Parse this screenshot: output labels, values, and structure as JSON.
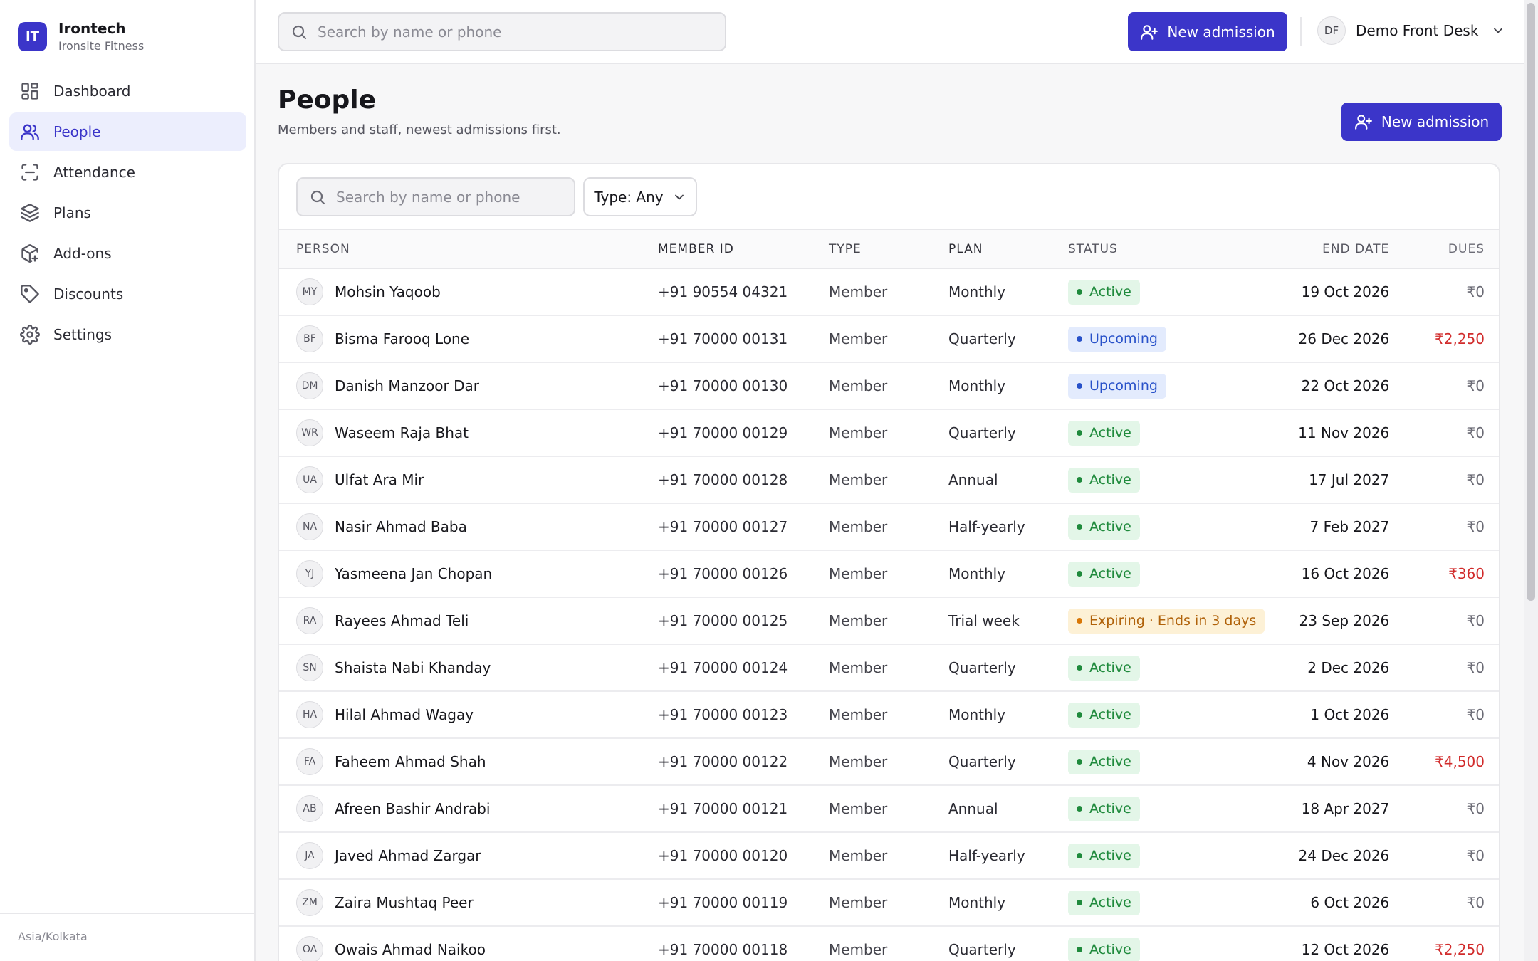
{
  "brand": {
    "initials": "IT",
    "name": "Irontech",
    "sub": "Ironsite Fitness"
  },
  "nav": [
    {
      "label": "Dashboard",
      "icon": "dashboard-icon"
    },
    {
      "label": "People",
      "icon": "people-icon",
      "active": true
    },
    {
      "label": "Attendance",
      "icon": "attendance-scan-icon"
    },
    {
      "label": "Plans",
      "icon": "layers-icon"
    },
    {
      "label": "Add-ons",
      "icon": "package-plus-icon"
    },
    {
      "label": "Discounts",
      "icon": "tag-icon"
    },
    {
      "label": "Settings",
      "icon": "gear-icon"
    }
  ],
  "timezone": "Asia/Kolkata",
  "topbar": {
    "search_placeholder": "Search by name or phone",
    "new_admission": "New admission",
    "user_initials": "DF",
    "user_name": "Demo Front Desk"
  },
  "page": {
    "title": "People",
    "subtitle": "Members and staff, newest admissions first.",
    "new_admission": "New admission"
  },
  "filters": {
    "search_placeholder": "Search by name or phone",
    "type_label": "Type: Any"
  },
  "table": {
    "columns": [
      "Person",
      "Member ID",
      "Type",
      "Plan",
      "Status",
      "End date",
      "Dues"
    ],
    "rows": [
      {
        "initials": "MY",
        "name": "Mohsin Yaqoob",
        "id": "+91 90554 04321",
        "type": "Member",
        "plan": "Monthly",
        "status": "Active",
        "status_kind": "active",
        "end": "19 Oct 2026",
        "dues": "₹0"
      },
      {
        "initials": "BF",
        "name": "Bisma Farooq Lone",
        "id": "+91 70000 00131",
        "type": "Member",
        "plan": "Quarterly",
        "status": "Upcoming",
        "status_kind": "upcoming",
        "end": "26 Dec 2026",
        "dues": "₹2,250"
      },
      {
        "initials": "DM",
        "name": "Danish Manzoor Dar",
        "id": "+91 70000 00130",
        "type": "Member",
        "plan": "Monthly",
        "status": "Upcoming",
        "status_kind": "upcoming",
        "end": "22 Oct 2026",
        "dues": "₹0"
      },
      {
        "initials": "WR",
        "name": "Waseem Raja Bhat",
        "id": "+91 70000 00129",
        "type": "Member",
        "plan": "Quarterly",
        "status": "Active",
        "status_kind": "active",
        "end": "11 Nov 2026",
        "dues": "₹0"
      },
      {
        "initials": "UA",
        "name": "Ulfat Ara Mir",
        "id": "+91 70000 00128",
        "type": "Member",
        "plan": "Annual",
        "status": "Active",
        "status_kind": "active",
        "end": "17 Jul 2027",
        "dues": "₹0"
      },
      {
        "initials": "NA",
        "name": "Nasir Ahmad Baba",
        "id": "+91 70000 00127",
        "type": "Member",
        "plan": "Half-yearly",
        "status": "Active",
        "status_kind": "active",
        "end": "7 Feb 2027",
        "dues": "₹0"
      },
      {
        "initials": "YJ",
        "name": "Yasmeena Jan Chopan",
        "id": "+91 70000 00126",
        "type": "Member",
        "plan": "Monthly",
        "status": "Active",
        "status_kind": "active",
        "end": "16 Oct 2026",
        "dues": "₹360"
      },
      {
        "initials": "RA",
        "name": "Rayees Ahmad Teli",
        "id": "+91 70000 00125",
        "type": "Member",
        "plan": "Trial week",
        "status": "Expiring · Ends in 3 days",
        "status_kind": "expiring",
        "end": "23 Sep 2026",
        "dues": "₹0"
      },
      {
        "initials": "SN",
        "name": "Shaista Nabi Khanday",
        "id": "+91 70000 00124",
        "type": "Member",
        "plan": "Quarterly",
        "status": "Active",
        "status_kind": "active",
        "end": "2 Dec 2026",
        "dues": "₹0"
      },
      {
        "initials": "HA",
        "name": "Hilal Ahmad Wagay",
        "id": "+91 70000 00123",
        "type": "Member",
        "plan": "Monthly",
        "status": "Active",
        "status_kind": "active",
        "end": "1 Oct 2026",
        "dues": "₹0"
      },
      {
        "initials": "FA",
        "name": "Faheem Ahmad Shah",
        "id": "+91 70000 00122",
        "type": "Member",
        "plan": "Quarterly",
        "status": "Active",
        "status_kind": "active",
        "end": "4 Nov 2026",
        "dues": "₹4,500"
      },
      {
        "initials": "AB",
        "name": "Afreen Bashir Andrabi",
        "id": "+91 70000 00121",
        "type": "Member",
        "plan": "Annual",
        "status": "Active",
        "status_kind": "active",
        "end": "18 Apr 2027",
        "dues": "₹0"
      },
      {
        "initials": "JA",
        "name": "Javed Ahmad Zargar",
        "id": "+91 70000 00120",
        "type": "Member",
        "plan": "Half-yearly",
        "status": "Active",
        "status_kind": "active",
        "end": "24 Dec 2026",
        "dues": "₹0"
      },
      {
        "initials": "ZM",
        "name": "Zaira Mushtaq Peer",
        "id": "+91 70000 00119",
        "type": "Member",
        "plan": "Monthly",
        "status": "Active",
        "status_kind": "active",
        "end": "6 Oct 2026",
        "dues": "₹0"
      },
      {
        "initials": "OA",
        "name": "Owais Ahmad Naikoo",
        "id": "+91 70000 00118",
        "type": "Member",
        "plan": "Quarterly",
        "status": "Active",
        "status_kind": "active",
        "end": "12 Oct 2026",
        "dues": "₹2,250"
      }
    ]
  },
  "colors": {
    "accent": "#3b35c9",
    "active": "#1f8a3c",
    "upcoming": "#2851c9",
    "expiring": "#b0620a",
    "due": "#d12b2b"
  }
}
